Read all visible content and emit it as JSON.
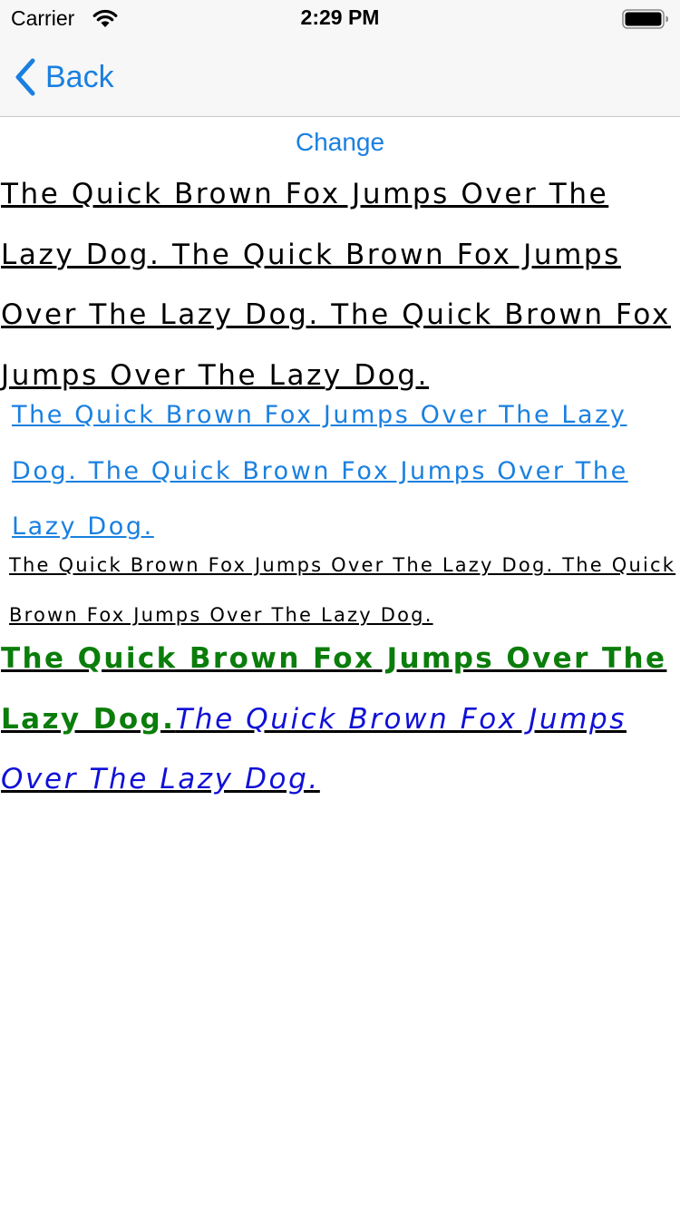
{
  "status_bar": {
    "carrier": "Carrier",
    "time": "2:29 PM"
  },
  "nav": {
    "back_label": "Back"
  },
  "actions": {
    "change_label": "Change"
  },
  "paragraphs": {
    "p1": "The Quick Brown Fox Jumps Over The Lazy Dog. The Quick Brown Fox Jumps Over The Lazy Dog. The Quick Brown Fox Jumps Over The Lazy Dog.",
    "p2": "The Quick Brown Fox Jumps Over The Lazy Dog. The Quick Brown Fox Jumps Over The Lazy Dog.",
    "p3": "The Quick Brown Fox Jumps Over The Lazy Dog. The Quick Brown Fox Jumps Over The Lazy Dog.",
    "p4_bold": "The Quick Brown Fox Jumps Over The Lazy Dog.",
    "p4_italic": "The Quick Brown Fox Jumps Over The Lazy Dog."
  },
  "colors": {
    "accent": "#1a80e0",
    "green": "#0a7d0a",
    "italic_blue": "#1010d8",
    "bar_background": "#f7f7f7"
  },
  "icons": {
    "wifi": "wifi-icon",
    "battery": "battery-icon",
    "back": "chevron-left-icon"
  }
}
